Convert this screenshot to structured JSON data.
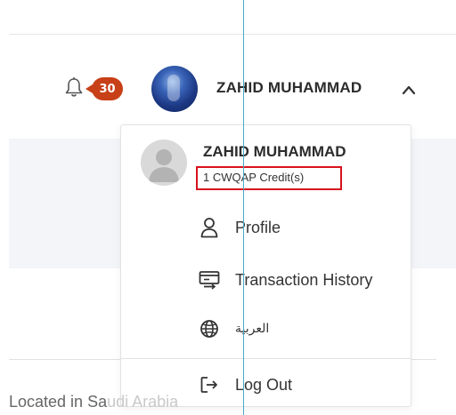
{
  "header": {
    "notification_count": "30",
    "user_name": "ZAHID MUHAMMAD"
  },
  "dropdown": {
    "user_name": "ZAHID MUHAMMAD",
    "credits": "1 CWQAP Credit(s)",
    "items": [
      {
        "label": "Profile",
        "icon": "person-icon"
      },
      {
        "label": "Transaction History",
        "icon": "transaction-history-icon"
      },
      {
        "label": "العربية",
        "icon": "globe-icon"
      },
      {
        "label": "Log Out",
        "icon": "logout-icon"
      }
    ]
  },
  "page": {
    "location_visible": "Located in Sa",
    "location_obscured": "udi Arabia"
  },
  "colors": {
    "badge": "#c84018",
    "highlight_box": "#d6131c",
    "guide_line": "#4aa9c8"
  }
}
